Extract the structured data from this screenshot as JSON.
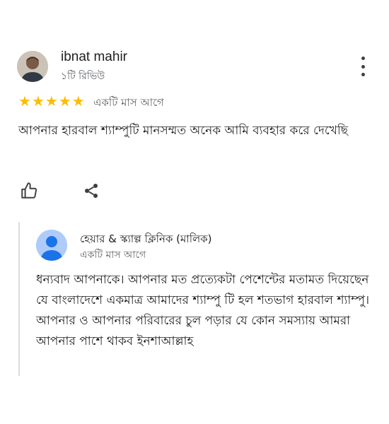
{
  "review": {
    "author_name": "ibnat mahir",
    "author_meta": "১টি রিভিউ",
    "rating": 5,
    "time": "একটি মাস আগে",
    "text": "আপনার হারবাল শ্যাম্পুটি মানসম্মত অনেক আমি ব্যবহার করে দেখেছি"
  },
  "icons": {
    "more": "more-vert-icon",
    "like": "thumbs-up-icon",
    "share": "share-icon",
    "star": "star-icon"
  },
  "owner_reply": {
    "name": "হেয়ার & স্ক্যাল্প ক্লিনিক (মালিক)",
    "time": "একটি মাস আগে",
    "text": "ধন্যবাদ আপনাকে। আপনার মত প্রত্যেকটা পেশেন্টের মতামত দিয়েছেন যে বাংলাদেশে একমাত্র আমাদের শ্যাম্পু টি হল শতভাগ হারবাল শ্যাম্পু। আপনার ও আপনার পরিবারের চুল পড়ার যে কোন সমস্যায় আমরা আপনার পাশে থাকব ইনশাআল্লাহ"
  },
  "colors": {
    "star": "#fbbc04",
    "secondary_text": "#5f6368",
    "owner_avatar_bg": "#aecbfa",
    "owner_avatar_fg": "#1a73e8"
  }
}
